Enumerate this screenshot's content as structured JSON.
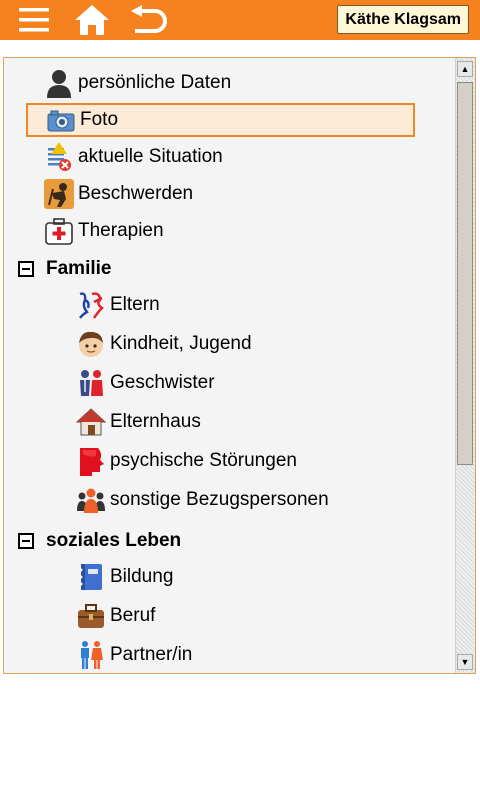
{
  "header": {
    "menu_icon": "hamburger-menu-icon",
    "home_icon": "home-icon",
    "back_icon": "undo-back-icon",
    "user_name": "Käthe Klagsam",
    "accent_color": "#f6821f"
  },
  "tree": {
    "items_top": [
      {
        "label": "persönliche Daten",
        "icon": "person-icon"
      },
      {
        "label": "Foto",
        "icon": "camera-icon",
        "selected": true
      },
      {
        "label": "aktuelle Situation",
        "icon": "checklist-alert-icon"
      },
      {
        "label": "Beschwerden",
        "icon": "complaint-person-icon"
      },
      {
        "label": "Therapien",
        "icon": "first-aid-kit-icon"
      }
    ],
    "groups": [
      {
        "label": "Familie",
        "expanded": true,
        "items": [
          {
            "label": "Eltern",
            "icon": "parents-icon"
          },
          {
            "label": "Kindheit, Jugend",
            "icon": "child-face-icon"
          },
          {
            "label": "Geschwister",
            "icon": "siblings-icon"
          },
          {
            "label": "Elternhaus",
            "icon": "house-icon"
          },
          {
            "label": "psychische Störungen",
            "icon": "head-profile-icon"
          },
          {
            "label": "sonstige Bezugspersonen",
            "icon": "group-people-icon"
          }
        ]
      },
      {
        "label": "soziales Leben",
        "expanded": true,
        "items": [
          {
            "label": "Bildung",
            "icon": "notebook-icon"
          },
          {
            "label": "Beruf",
            "icon": "briefcase-icon"
          },
          {
            "label": "Partner/in",
            "icon": "couple-icon"
          }
        ]
      }
    ]
  }
}
